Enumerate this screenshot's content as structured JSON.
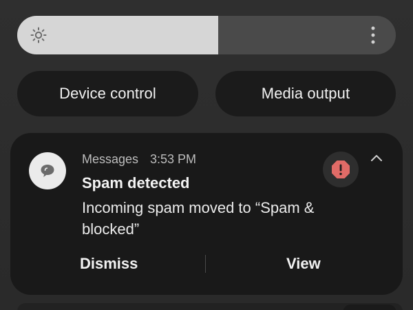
{
  "quick_panel": {
    "brightness": {
      "level_fraction": 0.53,
      "icon": "sun-icon",
      "menu_icon": "more-vert-icon"
    },
    "device_control_label": "Device control",
    "media_output_label": "Media output"
  },
  "notification": {
    "app_icon": "chat-bubble-icon",
    "app_name": "Messages",
    "time": "3:53 PM",
    "title": "Spam detected",
    "body": "Incoming spam moved to “Spam & blocked”",
    "badge_icon": "alert-octagon-icon",
    "badge_color": "#e06b67",
    "collapse_icon": "chevron-up-icon",
    "actions": {
      "dismiss": "Dismiss",
      "view": "View"
    }
  }
}
